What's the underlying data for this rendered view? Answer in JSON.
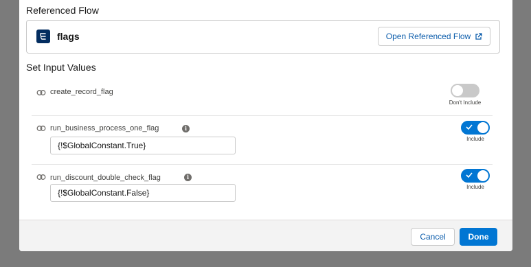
{
  "referenced_flow": {
    "section_title": "Referenced Flow",
    "flow_name": "flags",
    "flow_icon": "flow-icon",
    "open_button_label": "Open Referenced Flow",
    "open_button_icon": "external-link-icon"
  },
  "inputs": {
    "section_title": "Set Input Values",
    "rows": [
      {
        "name": "create_record_flag",
        "has_info": false,
        "value": "",
        "include": false,
        "toggle_label": "Don't Include"
      },
      {
        "name": "run_business_process_one_flag",
        "has_info": true,
        "value": "{!$GlobalConstant.True}",
        "include": true,
        "toggle_label": "Include"
      },
      {
        "name": "run_discount_double_check_flag",
        "has_info": true,
        "value": "{!$GlobalConstant.False}",
        "include": true,
        "toggle_label": "Include"
      }
    ]
  },
  "footer": {
    "cancel_label": "Cancel",
    "done_label": "Done"
  },
  "colors": {
    "brand_blue": "#0176d3",
    "link_blue": "#0b5cab",
    "flow_icon_bg": "#032d60"
  }
}
